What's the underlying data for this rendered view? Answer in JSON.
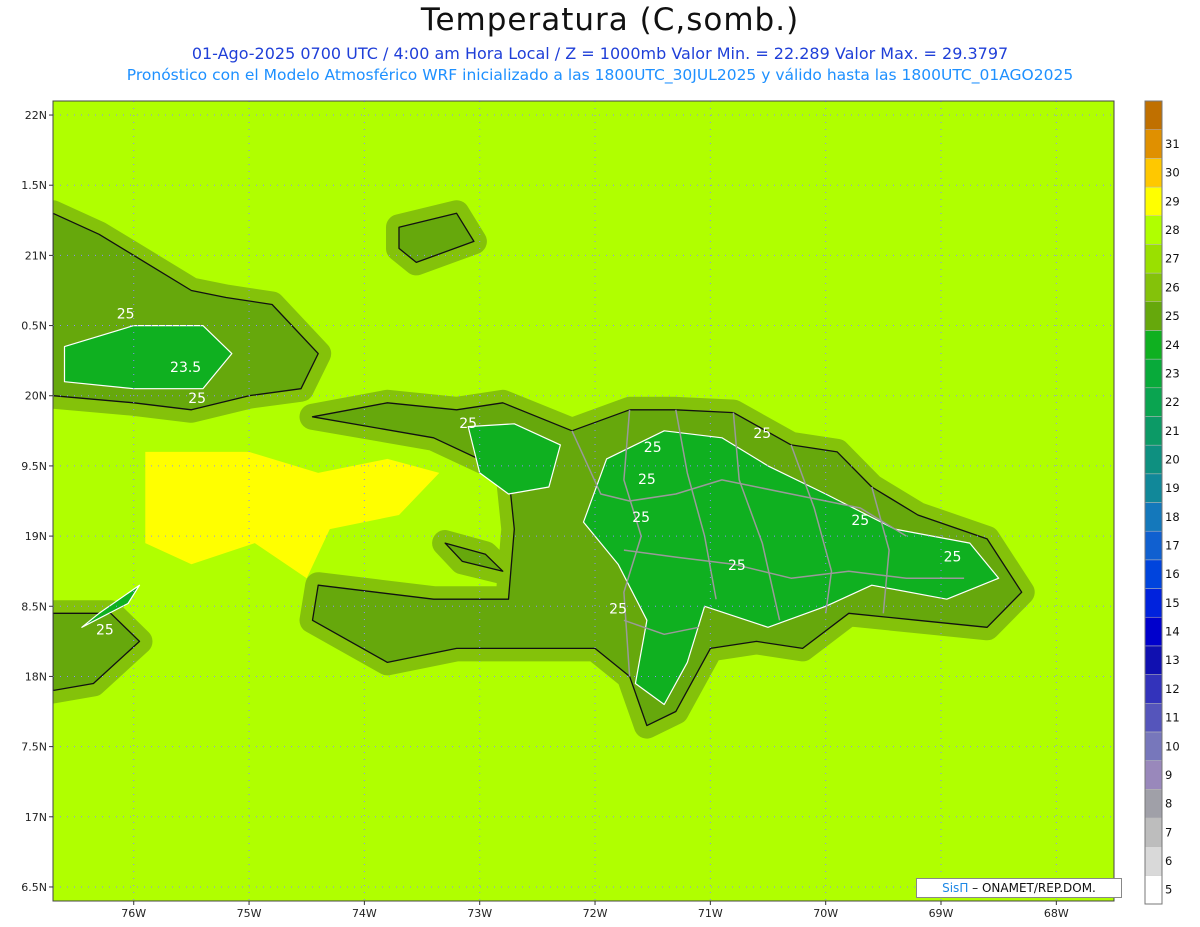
{
  "title": "Temperatura (C,somb.)",
  "subtitle_line1": "01-Ago-2025  0700 UTC / 4:00 am Hora Local / Z = 1000mb    Valor Min. = 22.289  Valor Max. = 29.3797",
  "subtitle_line2": "Pronóstico con el Modelo Atmosférico WRF inicializado a las 1800UTC_30JUL2025 y válido hasta las  1800UTC_01AGO2025",
  "credit": {
    "brand": "SisΠ",
    "text": " – ONAMET/REP.DOM."
  },
  "colors": {
    "land_contour": "#111111",
    "province_borders": "#9a9a9a",
    "isotherm": "#ffffff",
    "grid": "#8a8aff"
  },
  "chart_data": {
    "type": "heatmap",
    "variable": "Temperatura (C,somb.)",
    "level": "Z = 1000mb",
    "valid_time": "01-Ago-2025 0700 UTC",
    "min_value": 22.289,
    "max_value": 29.3797,
    "xlim": [
      -76.7,
      -67.5
    ],
    "ylim": [
      16.4,
      22.1
    ],
    "x_ticks": [
      {
        "value": -76,
        "label": "76W"
      },
      {
        "value": -75,
        "label": "75W"
      },
      {
        "value": -74,
        "label": "74W"
      },
      {
        "value": -73,
        "label": "73W"
      },
      {
        "value": -72,
        "label": "72W"
      },
      {
        "value": -71,
        "label": "71W"
      },
      {
        "value": -70,
        "label": "70W"
      },
      {
        "value": -69,
        "label": "69W"
      },
      {
        "value": -68,
        "label": "68W"
      }
    ],
    "y_ticks": [
      {
        "value": 22,
        "label": "22N"
      },
      {
        "value": 21.5,
        "label": "1.5N"
      },
      {
        "value": 21,
        "label": "21N"
      },
      {
        "value": 20.5,
        "label": "0.5N"
      },
      {
        "value": 20,
        "label": "20N"
      },
      {
        "value": 19.5,
        "label": "9.5N"
      },
      {
        "value": 19,
        "label": "19N"
      },
      {
        "value": 18.5,
        "label": "8.5N"
      },
      {
        "value": 18,
        "label": "18N"
      },
      {
        "value": 17.5,
        "label": "7.5N"
      },
      {
        "value": 17,
        "label": "17N"
      },
      {
        "value": 16.5,
        "label": "6.5N"
      }
    ],
    "grid": true,
    "colorbar": {
      "placement": "right",
      "levels": [
        {
          "label": "5",
          "color": "#ffffff"
        },
        {
          "label": "6",
          "color": "#d9d9d9"
        },
        {
          "label": "7",
          "color": "#bdbdbd"
        },
        {
          "label": "8",
          "color": "#a0a0a8"
        },
        {
          "label": "9",
          "color": "#9988bb"
        },
        {
          "label": "10",
          "color": "#7777bb"
        },
        {
          "label": "11",
          "color": "#5555bb"
        },
        {
          "label": "12",
          "color": "#3333bb"
        },
        {
          "label": "13",
          "color": "#1010b0"
        },
        {
          "label": "14",
          "color": "#0000cc"
        },
        {
          "label": "15",
          "color": "#0022dd"
        },
        {
          "label": "16",
          "color": "#0044dd"
        },
        {
          "label": "17",
          "color": "#1060d0"
        },
        {
          "label": "18",
          "color": "#1478bb"
        },
        {
          "label": "19",
          "color": "#118899"
        },
        {
          "label": "20",
          "color": "#0e9080"
        },
        {
          "label": "21",
          "color": "#0c9a66"
        },
        {
          "label": "22",
          "color": "#0aa450"
        },
        {
          "label": "23",
          "color": "#08aa3a"
        },
        {
          "label": "24",
          "color": "#0fb020"
        },
        {
          "label": "25",
          "color": "#66a80c"
        },
        {
          "label": "26",
          "color": "#84c20a"
        },
        {
          "label": "27",
          "color": "#9ae000"
        },
        {
          "label": "28",
          "color": "#b0ff00"
        },
        {
          "label": "29",
          "color": "#ffff00"
        },
        {
          "label": "30",
          "color": "#ffc800"
        },
        {
          "label": "31",
          "color": "#e09000"
        },
        {
          "label": "",
          "color": "#c07000"
        }
      ]
    },
    "contour_labels": [
      {
        "text": "25",
        "lon": -76.07,
        "lat": 20.55
      },
      {
        "text": "23.5",
        "lon": -75.55,
        "lat": 20.17
      },
      {
        "text": "25",
        "lon": -75.45,
        "lat": 19.95
      },
      {
        "text": "25",
        "lon": -73.1,
        "lat": 19.77
      },
      {
        "text": "25",
        "lon": -71.5,
        "lat": 19.6
      },
      {
        "text": "25",
        "lon": -70.55,
        "lat": 19.7
      },
      {
        "text": "25",
        "lon": -71.55,
        "lat": 19.37
      },
      {
        "text": "25",
        "lon": -71.6,
        "lat": 19.1
      },
      {
        "text": "25",
        "lon": -69.7,
        "lat": 19.08
      },
      {
        "text": "25",
        "lon": -68.9,
        "lat": 18.82
      },
      {
        "text": "25",
        "lon": -70.77,
        "lat": 18.76
      },
      {
        "text": "25",
        "lon": -71.8,
        "lat": 18.45
      },
      {
        "text": "25",
        "lon": -76.25,
        "lat": 18.3
      }
    ],
    "regions": [
      {
        "kind": "land",
        "level": "25",
        "name": "Cuba",
        "outline": [
          [
            -76.7,
            21.3
          ],
          [
            -76.3,
            21.15
          ],
          [
            -75.9,
            20.95
          ],
          [
            -75.5,
            20.75
          ],
          [
            -75.2,
            20.7
          ],
          [
            -74.8,
            20.65
          ],
          [
            -74.4,
            20.3
          ],
          [
            -74.55,
            20.05
          ],
          [
            -75.0,
            20.0
          ],
          [
            -75.5,
            19.9
          ],
          [
            -76.0,
            19.95
          ],
          [
            -76.7,
            20.0
          ]
        ]
      },
      {
        "kind": "land",
        "level": "25",
        "name": "Hispaniola",
        "outline": [
          [
            -74.45,
            19.85
          ],
          [
            -73.8,
            19.95
          ],
          [
            -73.2,
            19.9
          ],
          [
            -72.8,
            19.95
          ],
          [
            -72.2,
            19.75
          ],
          [
            -71.7,
            19.9
          ],
          [
            -71.3,
            19.9
          ],
          [
            -70.8,
            19.88
          ],
          [
            -70.3,
            19.65
          ],
          [
            -69.9,
            19.6
          ],
          [
            -69.6,
            19.35
          ],
          [
            -69.2,
            19.15
          ],
          [
            -68.6,
            18.98
          ],
          [
            -68.3,
            18.6
          ],
          [
            -68.6,
            18.35
          ],
          [
            -69.2,
            18.4
          ],
          [
            -69.8,
            18.45
          ],
          [
            -70.2,
            18.2
          ],
          [
            -70.6,
            18.25
          ],
          [
            -71.0,
            18.2
          ],
          [
            -71.3,
            17.75
          ],
          [
            -71.55,
            17.65
          ],
          [
            -71.7,
            18.0
          ],
          [
            -72.0,
            18.2
          ],
          [
            -72.6,
            18.2
          ],
          [
            -73.2,
            18.2
          ],
          [
            -73.8,
            18.1
          ],
          [
            -74.45,
            18.4
          ],
          [
            -74.4,
            18.65
          ],
          [
            -73.9,
            18.6
          ],
          [
            -73.4,
            18.55
          ],
          [
            -72.75,
            18.55
          ],
          [
            -72.7,
            19.05
          ],
          [
            -72.75,
            19.45
          ],
          [
            -73.4,
            19.7
          ]
        ]
      },
      {
        "kind": "land",
        "level": "25",
        "name": "Jamaica",
        "outline": [
          [
            -76.7,
            18.45
          ],
          [
            -76.2,
            18.45
          ],
          [
            -75.95,
            18.25
          ],
          [
            -76.35,
            17.95
          ],
          [
            -76.7,
            17.9
          ]
        ]
      },
      {
        "kind": "land",
        "level": "25",
        "name": "Great Inagua",
        "outline": [
          [
            -73.7,
            21.2
          ],
          [
            -73.2,
            21.3
          ],
          [
            -73.05,
            21.1
          ],
          [
            -73.55,
            20.95
          ],
          [
            -73.7,
            21.05
          ]
        ]
      },
      {
        "kind": "land",
        "level": "25",
        "name": "Gonave",
        "outline": [
          [
            -73.3,
            18.95
          ],
          [
            -72.95,
            18.87
          ],
          [
            -72.8,
            18.75
          ],
          [
            -73.15,
            18.82
          ]
        ]
      },
      {
        "kind": "warm",
        "level": "29",
        "name": "Windward warm pool",
        "outline": [
          [
            -75.9,
            19.6
          ],
          [
            -75.0,
            19.6
          ],
          [
            -74.4,
            19.45
          ],
          [
            -73.8,
            19.55
          ],
          [
            -73.35,
            19.45
          ],
          [
            -73.7,
            19.15
          ],
          [
            -74.3,
            19.05
          ],
          [
            -74.5,
            18.7
          ],
          [
            -74.95,
            18.95
          ],
          [
            -75.5,
            18.8
          ],
          [
            -75.9,
            18.95
          ]
        ]
      },
      {
        "kind": "inner",
        "level": "24",
        "name": "Cuba interior",
        "outline": [
          [
            -76.6,
            20.35
          ],
          [
            -76.0,
            20.5
          ],
          [
            -75.4,
            20.5
          ],
          [
            -75.15,
            20.3
          ],
          [
            -75.4,
            20.05
          ],
          [
            -76.0,
            20.05
          ],
          [
            -76.6,
            20.1
          ]
        ]
      },
      {
        "kind": "inner",
        "level": "24",
        "name": "Cordillera Central",
        "outline": [
          [
            -71.9,
            19.55
          ],
          [
            -71.4,
            19.75
          ],
          [
            -70.9,
            19.7
          ],
          [
            -70.5,
            19.5
          ],
          [
            -70.0,
            19.3
          ],
          [
            -69.4,
            19.05
          ],
          [
            -68.75,
            18.95
          ],
          [
            -68.5,
            18.7
          ],
          [
            -68.95,
            18.55
          ],
          [
            -69.6,
            18.65
          ],
          [
            -70.0,
            18.5
          ],
          [
            -70.5,
            18.35
          ],
          [
            -71.05,
            18.5
          ],
          [
            -71.2,
            18.1
          ],
          [
            -71.4,
            17.8
          ],
          [
            -71.65,
            17.95
          ],
          [
            -71.55,
            18.4
          ],
          [
            -71.8,
            18.8
          ],
          [
            -72.1,
            19.1
          ]
        ]
      },
      {
        "kind": "inner",
        "level": "24",
        "name": "Northern Haiti",
        "outline": [
          [
            -73.1,
            19.78
          ],
          [
            -72.7,
            19.8
          ],
          [
            -72.3,
            19.65
          ],
          [
            -72.4,
            19.35
          ],
          [
            -72.75,
            19.3
          ],
          [
            -73.0,
            19.45
          ]
        ]
      },
      {
        "kind": "inner",
        "level": "24",
        "name": "Jamaica interior",
        "outline": [
          [
            -76.45,
            18.35
          ],
          [
            -76.05,
            18.52
          ],
          [
            -75.95,
            18.65
          ],
          [
            -76.3,
            18.45
          ]
        ]
      }
    ]
  }
}
